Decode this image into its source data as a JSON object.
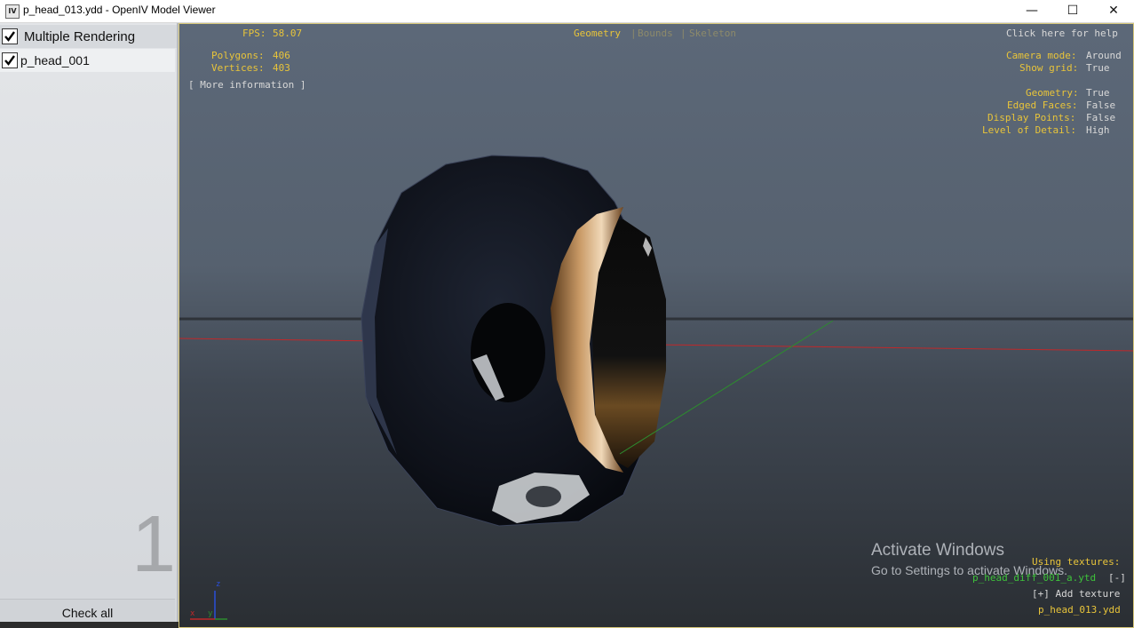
{
  "window": {
    "icon_label": "IV",
    "title": "p_head_013.ydd - OpenIV Model Viewer",
    "minimize": "—",
    "maximize": "☐",
    "close": "✕"
  },
  "sidebar": {
    "header_label": "Multiple Rendering",
    "items": [
      {
        "label": "p_head_001",
        "checked": true
      }
    ],
    "count": "1",
    "check_all": "Check all"
  },
  "viewport": {
    "fps_label": "FPS:",
    "fps_value": "58.07",
    "polygons_label": "Polygons:",
    "polygons_value": "406",
    "vertices_label": "Vertices:",
    "vertices_value": "403",
    "more_info": "[ More information ]",
    "modes": [
      "Geometry",
      "Bounds",
      "Skeleton"
    ],
    "separator": "|",
    "help": "Click here for help",
    "settings": [
      {
        "label": "Camera mode:",
        "value": "Around"
      },
      {
        "label": "Show grid:",
        "value": "True"
      },
      {
        "label": "Geometry:",
        "value": "True"
      },
      {
        "label": "Edged Faces:",
        "value": "False"
      },
      {
        "label": "Display Points:",
        "value": "False"
      },
      {
        "label": "Level of Detail:",
        "value": "High"
      }
    ],
    "using_textures": "Using textures:",
    "texture_file": "p_head_diff_001_a.ytd",
    "remove": "[-]",
    "add_texture": "[+] Add texture",
    "model_file": "p_head_013.ydd",
    "axis_labels": {
      "x": "x",
      "y": "y",
      "z": "z"
    }
  },
  "activation": {
    "title": "Activate Windows",
    "subtitle": "Go to Settings to activate Windows."
  },
  "colors": {
    "accent_yellow": "#e8c43a",
    "text_white": "#d8d8d8",
    "link_green": "#3ec33a"
  }
}
